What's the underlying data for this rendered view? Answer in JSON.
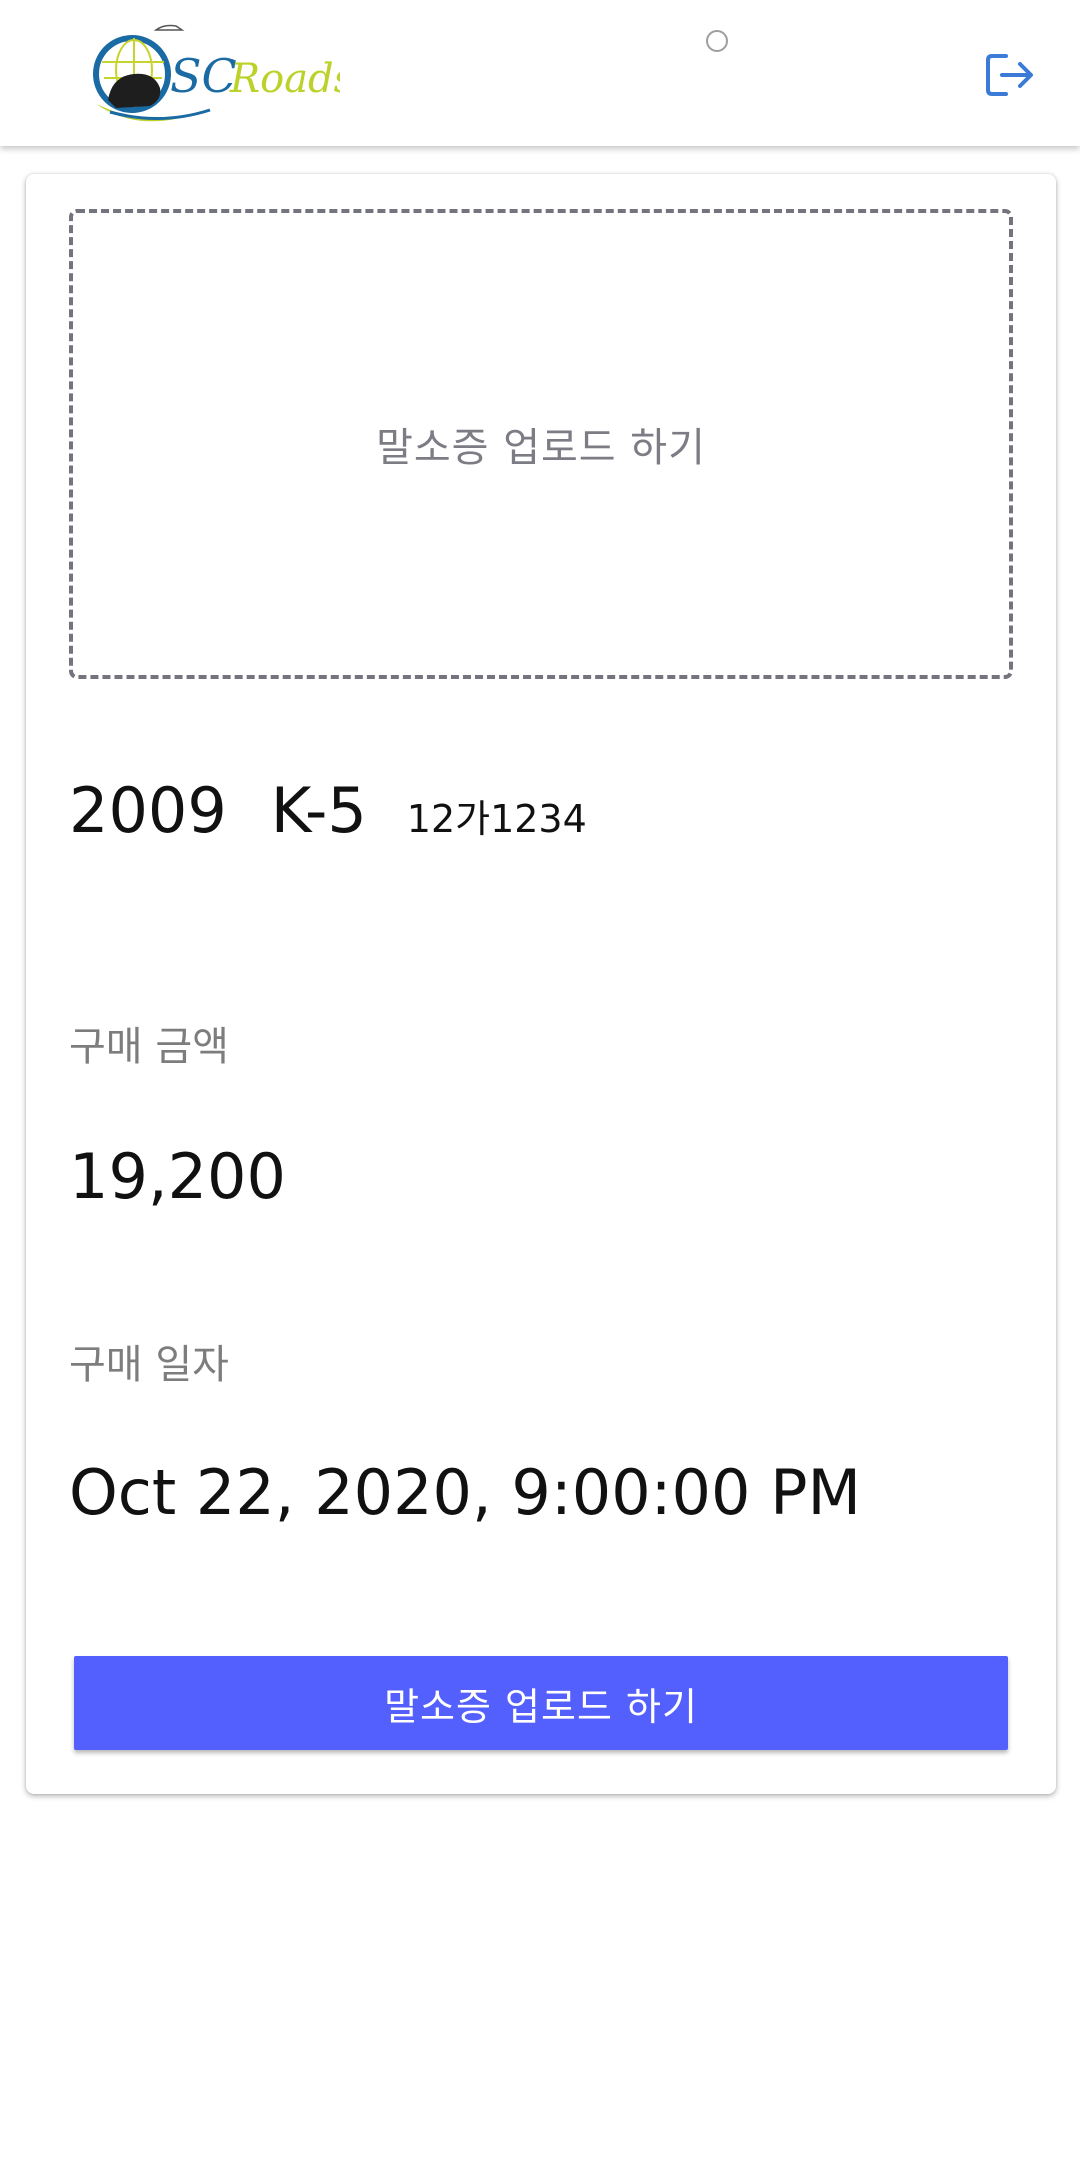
{
  "header": {
    "logo_text_sc": "SC",
    "logo_text_roads": "Roads",
    "logout_icon": "logout-icon",
    "status_icon": "circle-icon"
  },
  "card": {
    "dropzone_label": "말소증 업로드 하기",
    "car": {
      "year": "2009",
      "model": "K-5",
      "plate": "12가1234"
    },
    "price": {
      "label": "구매 금액",
      "value": "19,200"
    },
    "date": {
      "label": "구매 일자",
      "value": "Oct 22, 2020, 9:00:00 PM"
    },
    "upload_button_label": "말소증 업로드 하기"
  },
  "colors": {
    "primary": "#5460fe",
    "logout_icon": "#3b7bd6",
    "logo_blue": "#1a6aa3",
    "logo_green": "#bcd12a"
  }
}
